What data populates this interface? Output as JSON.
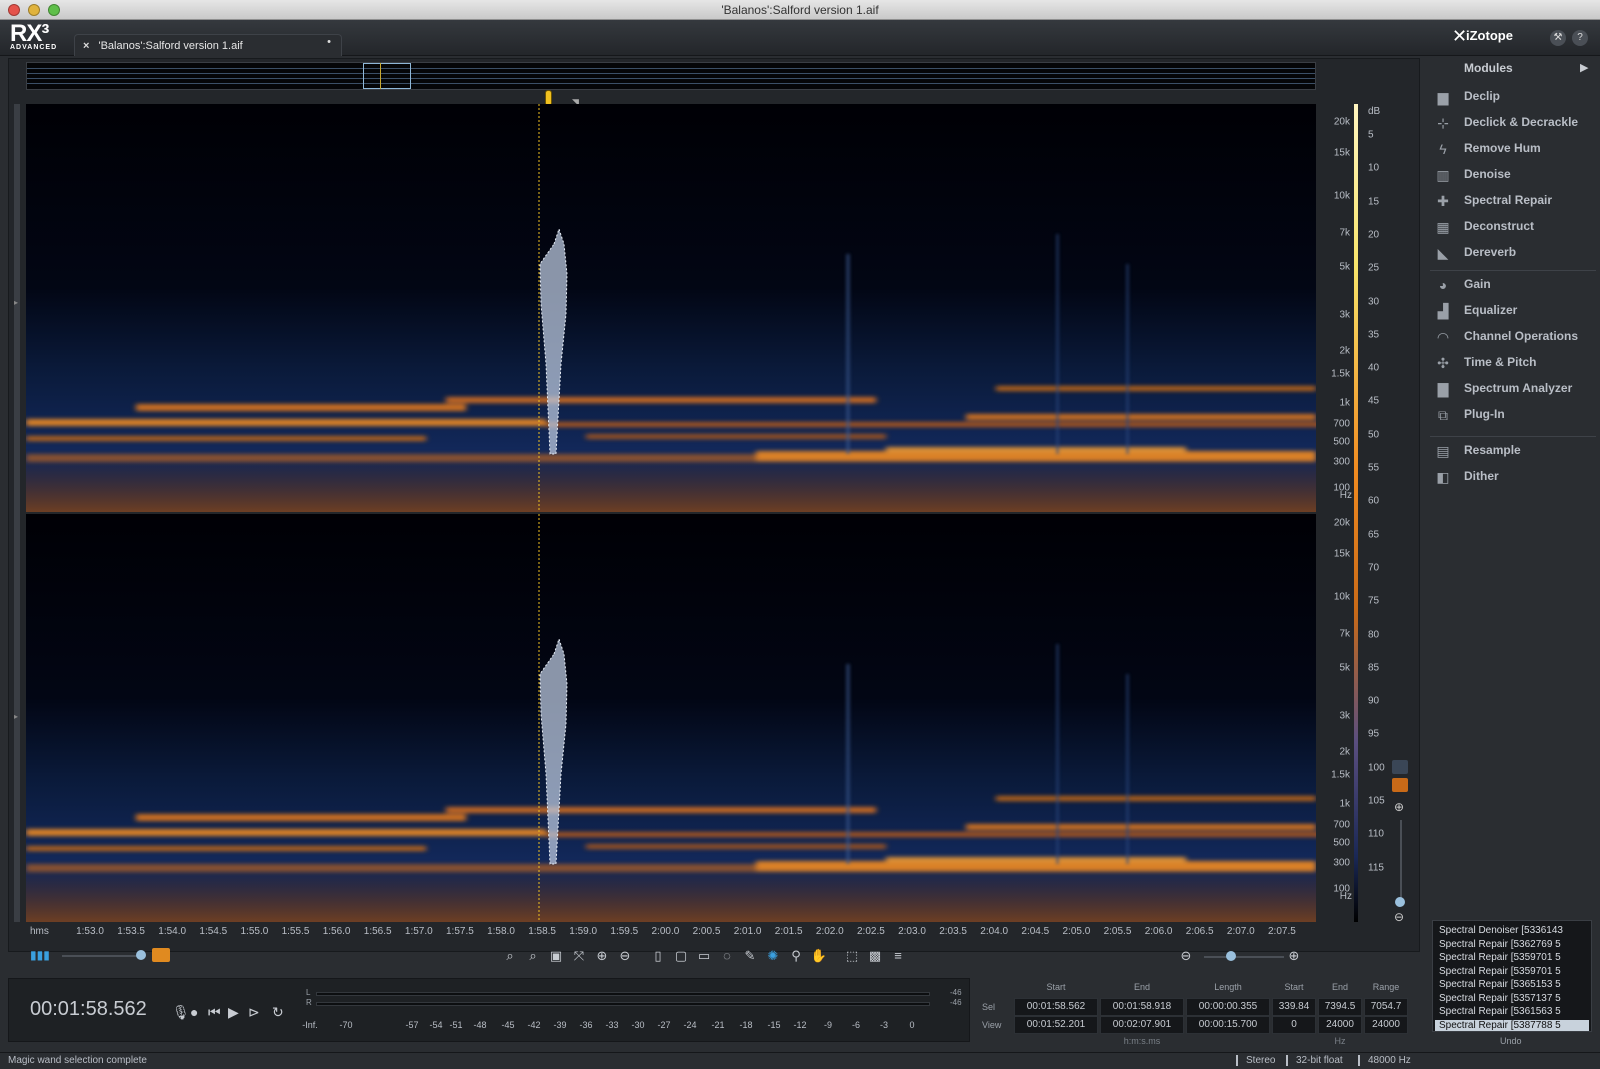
{
  "window": {
    "title": "'Balanos':Salford version 1.aif"
  },
  "app": {
    "logo": "RX³",
    "edition": "ADVANCED",
    "brand": "iZotope"
  },
  "tab": {
    "label": "'Balanos':Salford version 1.aif",
    "close": "×",
    "modified": "•"
  },
  "freq_axis": {
    "unit": "Hz",
    "labels": [
      "20k",
      "15k",
      "10k",
      "7k",
      "5k",
      "3k",
      "2k",
      "1.5k",
      "1k",
      "700",
      "500",
      "300",
      "100"
    ]
  },
  "db_axis": {
    "unit": "dB",
    "labels": [
      "5",
      "10",
      "15",
      "20",
      "25",
      "30",
      "35",
      "40",
      "45",
      "50",
      "55",
      "60",
      "65",
      "70",
      "75",
      "80",
      "85",
      "90",
      "95",
      "100",
      "105",
      "110",
      "115"
    ]
  },
  "time_axis": {
    "unit": "hms",
    "labels": [
      "1:53.0",
      "1:53.5",
      "1:54.0",
      "1:54.5",
      "1:55.0",
      "1:55.5",
      "1:56.0",
      "1:56.5",
      "1:57.0",
      "1:57.5",
      "1:58.0",
      "1:58.5",
      "1:59.0",
      "1:59.5",
      "2:00.0",
      "2:00.5",
      "2:01.0",
      "2:01.5",
      "2:02.0",
      "2:02.5",
      "2:03.0",
      "2:03.5",
      "2:04.0",
      "2:04.5",
      "2:05.0",
      "2:05.5",
      "2:06.0",
      "2:06.5",
      "2:07.0",
      "2:07.5"
    ]
  },
  "transport": {
    "timecode": "00:01:58.562",
    "meter_left_peak": "-46",
    "meter_right_peak": "-46",
    "meter_channel_left": "L",
    "meter_channel_right": "R",
    "meter_scale": [
      "-Inf.",
      "-70",
      "-57",
      "-54",
      "-51",
      "-48",
      "-45",
      "-42",
      "-39",
      "-36",
      "-33",
      "-30",
      "-27",
      "-24",
      "-21",
      "-18",
      "-15",
      "-12",
      "-9",
      "-6",
      "-3",
      "0"
    ]
  },
  "selection_info": {
    "headers": {
      "start": "Start",
      "end": "End",
      "length": "Length",
      "f_start": "Start",
      "f_end": "End",
      "range": "Range"
    },
    "rows": {
      "sel": {
        "label": "Sel",
        "start": "00:01:58.562",
        "end": "00:01:58.918",
        "length": "00:00:00.355",
        "f_start": "339.84",
        "f_end": "7394.5",
        "range": "7054.7"
      },
      "view": {
        "label": "View",
        "start": "00:01:52.201",
        "end": "00:02:07.901",
        "length": "00:00:15.700",
        "f_start": "0",
        "f_end": "24000",
        "range": "24000"
      }
    },
    "time_unit": "h:m:s.ms",
    "freq_unit": "Hz"
  },
  "modules": {
    "title": "Modules",
    "items": [
      {
        "label": "Declip",
        "icon": "declip-icon",
        "glyph": "▆"
      },
      {
        "label": "Declick & Decrackle",
        "icon": "declick-icon",
        "glyph": "⊹"
      },
      {
        "label": "Remove Hum",
        "icon": "remove-hum-icon",
        "glyph": "ϟ"
      },
      {
        "label": "Denoise",
        "icon": "denoise-icon",
        "glyph": "▥"
      },
      {
        "label": "Spectral Repair",
        "icon": "spectral-repair-icon",
        "glyph": "✚"
      },
      {
        "label": "Deconstruct",
        "icon": "deconstruct-icon",
        "glyph": "▦"
      },
      {
        "label": "Dereverb",
        "icon": "dereverb-icon",
        "glyph": "◣"
      },
      {
        "label": "Gain",
        "icon": "gain-icon",
        "glyph": "◕"
      },
      {
        "label": "Equalizer",
        "icon": "equalizer-icon",
        "glyph": "▟"
      },
      {
        "label": "Channel Operations",
        "icon": "channel-operations-icon",
        "glyph": "◠"
      },
      {
        "label": "Time & Pitch",
        "icon": "time-pitch-icon",
        "glyph": "✣"
      },
      {
        "label": "Spectrum Analyzer",
        "icon": "spectrum-analyzer-icon",
        "glyph": "▇"
      },
      {
        "label": "Plug-In",
        "icon": "plugin-icon",
        "glyph": "⧉"
      },
      {
        "label": "Resample",
        "icon": "resample-icon",
        "glyph": "▤"
      },
      {
        "label": "Dither",
        "icon": "dither-icon",
        "glyph": "◧"
      }
    ]
  },
  "undo": {
    "label": "Undo",
    "items": [
      "Spectral Denoiser [5336143",
      "Spectral Repair [5362769 5",
      "Spectral Repair [5359701 5",
      "Spectral Repair [5359701 5",
      "Spectral Repair [5365153 5",
      "Spectral Repair [5357137 5",
      "Spectral Repair [5361563 5",
      "Spectral Repair [5387788 5"
    ],
    "selected_index": 7
  },
  "status": {
    "message": "Magic wand selection complete",
    "channels": "Stereo",
    "bit_depth": "32-bit float",
    "sample_rate": "48000 Hz"
  },
  "colors": {
    "accent": "#f08a20",
    "selection": "#c8d2dc",
    "playhead": "#f0c020"
  }
}
